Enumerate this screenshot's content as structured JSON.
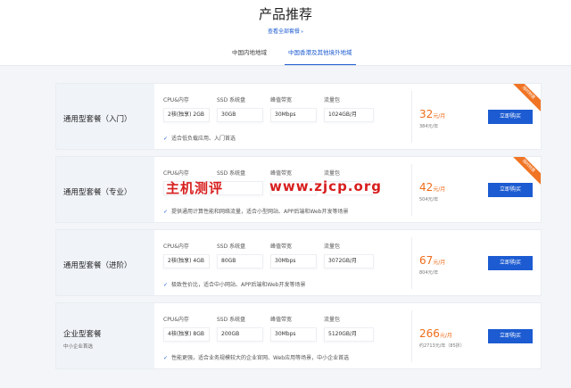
{
  "header": {
    "title": "产品推荐",
    "all_link": "查看全部套餐",
    "arrow": "»",
    "tabs": [
      {
        "label": "中国内地地域",
        "active": false
      },
      {
        "label": "中国香港及其他境外地域",
        "active": true
      }
    ]
  },
  "spec_labels": [
    "CPU&内存",
    "SSD 系统盘",
    "峰值带宽",
    "流量包"
  ],
  "buy_label": "立即购买",
  "check_icon": "✓",
  "ribbon_text": "限时特惠",
  "plans": [
    {
      "name": "通用型套餐（入门）",
      "sub": "",
      "specs": [
        "2核(独享) 2GB",
        "30GB",
        "30Mbps",
        "1024GB/月"
      ],
      "note": "适合低负载应用、入门首选",
      "price": "32",
      "unit": "元/月",
      "year": "384元/年",
      "ribbon": true
    },
    {
      "name": "通用型套餐（专业）",
      "sub": "",
      "specs": [
        "",
        "",
        "",
        ""
      ],
      "note": "提供通用计算性能和网络流量，适合小型网站、APP后端和Web开发等场景",
      "price": "42",
      "unit": "元/月",
      "year": "504元/年",
      "ribbon": true
    },
    {
      "name": "通用型套餐（进阶）",
      "sub": "",
      "specs": [
        "2核(独享) 4GB",
        "80GB",
        "30Mbps",
        "3072GB/月"
      ],
      "note": "极致性价比，适合中小网站、APP后端和Web开发等场景",
      "price": "67",
      "unit": "元/月",
      "year": "804元/年",
      "ribbon": false
    },
    {
      "name": "企业型套餐",
      "sub": "中小企业首选",
      "specs": [
        "4核(独享) 8GB",
        "200GB",
        "30Mbps",
        "5120GB/月"
      ],
      "note": "性能更强，适合业务规模较大的企业官网、Web应用等场景，中小企业首选",
      "price": "266",
      "unit": "元/月",
      "year": "约2713元/年（85折）",
      "ribbon": false
    }
  ],
  "watermark": {
    "text1": "主机测评",
    "text2": "www.zjcp.org"
  },
  "colors": {
    "accent": "#1c5bd1",
    "price": "#ef6c1a",
    "ribbon": "#f07424",
    "watermark": "#d81e1e"
  }
}
